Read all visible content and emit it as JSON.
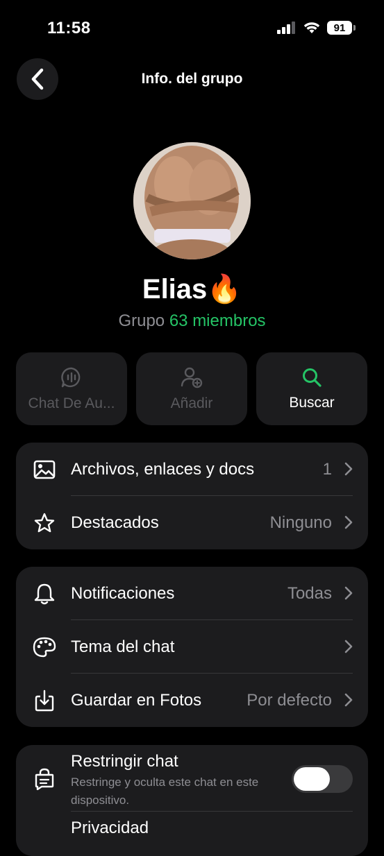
{
  "status_bar": {
    "time": "11:58",
    "battery": "91"
  },
  "header": {
    "title": "Info. del grupo"
  },
  "group": {
    "name": "Elias🔥",
    "type_label": "Grupo",
    "members": "63 miembros"
  },
  "actions": [
    {
      "label": "Chat De Au...",
      "icon": "audio-chat-icon",
      "enabled": false
    },
    {
      "label": "Añadir",
      "icon": "add-person-icon",
      "enabled": false
    },
    {
      "label": "Buscar",
      "icon": "search-icon",
      "enabled": true
    }
  ],
  "media_section": {
    "files": {
      "label": "Archivos, enlaces y docs",
      "value": "1",
      "icon": "image-icon"
    },
    "starred": {
      "label": "Destacados",
      "value": "Ninguno",
      "icon": "star-icon"
    }
  },
  "settings_section": {
    "notifications": {
      "label": "Notificaciones",
      "value": "Todas",
      "icon": "bell-icon"
    },
    "theme": {
      "label": "Tema del chat",
      "value": "",
      "icon": "palette-icon"
    },
    "save_photos": {
      "label": "Guardar en Fotos",
      "value": "Por defecto",
      "icon": "download-icon"
    }
  },
  "privacy_section": {
    "restrict": {
      "label": "Restringir chat",
      "description": "Restringe y oculta este chat en este dispositivo.",
      "enabled": false,
      "icon": "lock-chat-icon"
    },
    "privacy": {
      "label": "Privacidad"
    }
  },
  "colors": {
    "accent": "#25c466",
    "card": "#1c1c1e",
    "muted": "#8e8e93"
  }
}
